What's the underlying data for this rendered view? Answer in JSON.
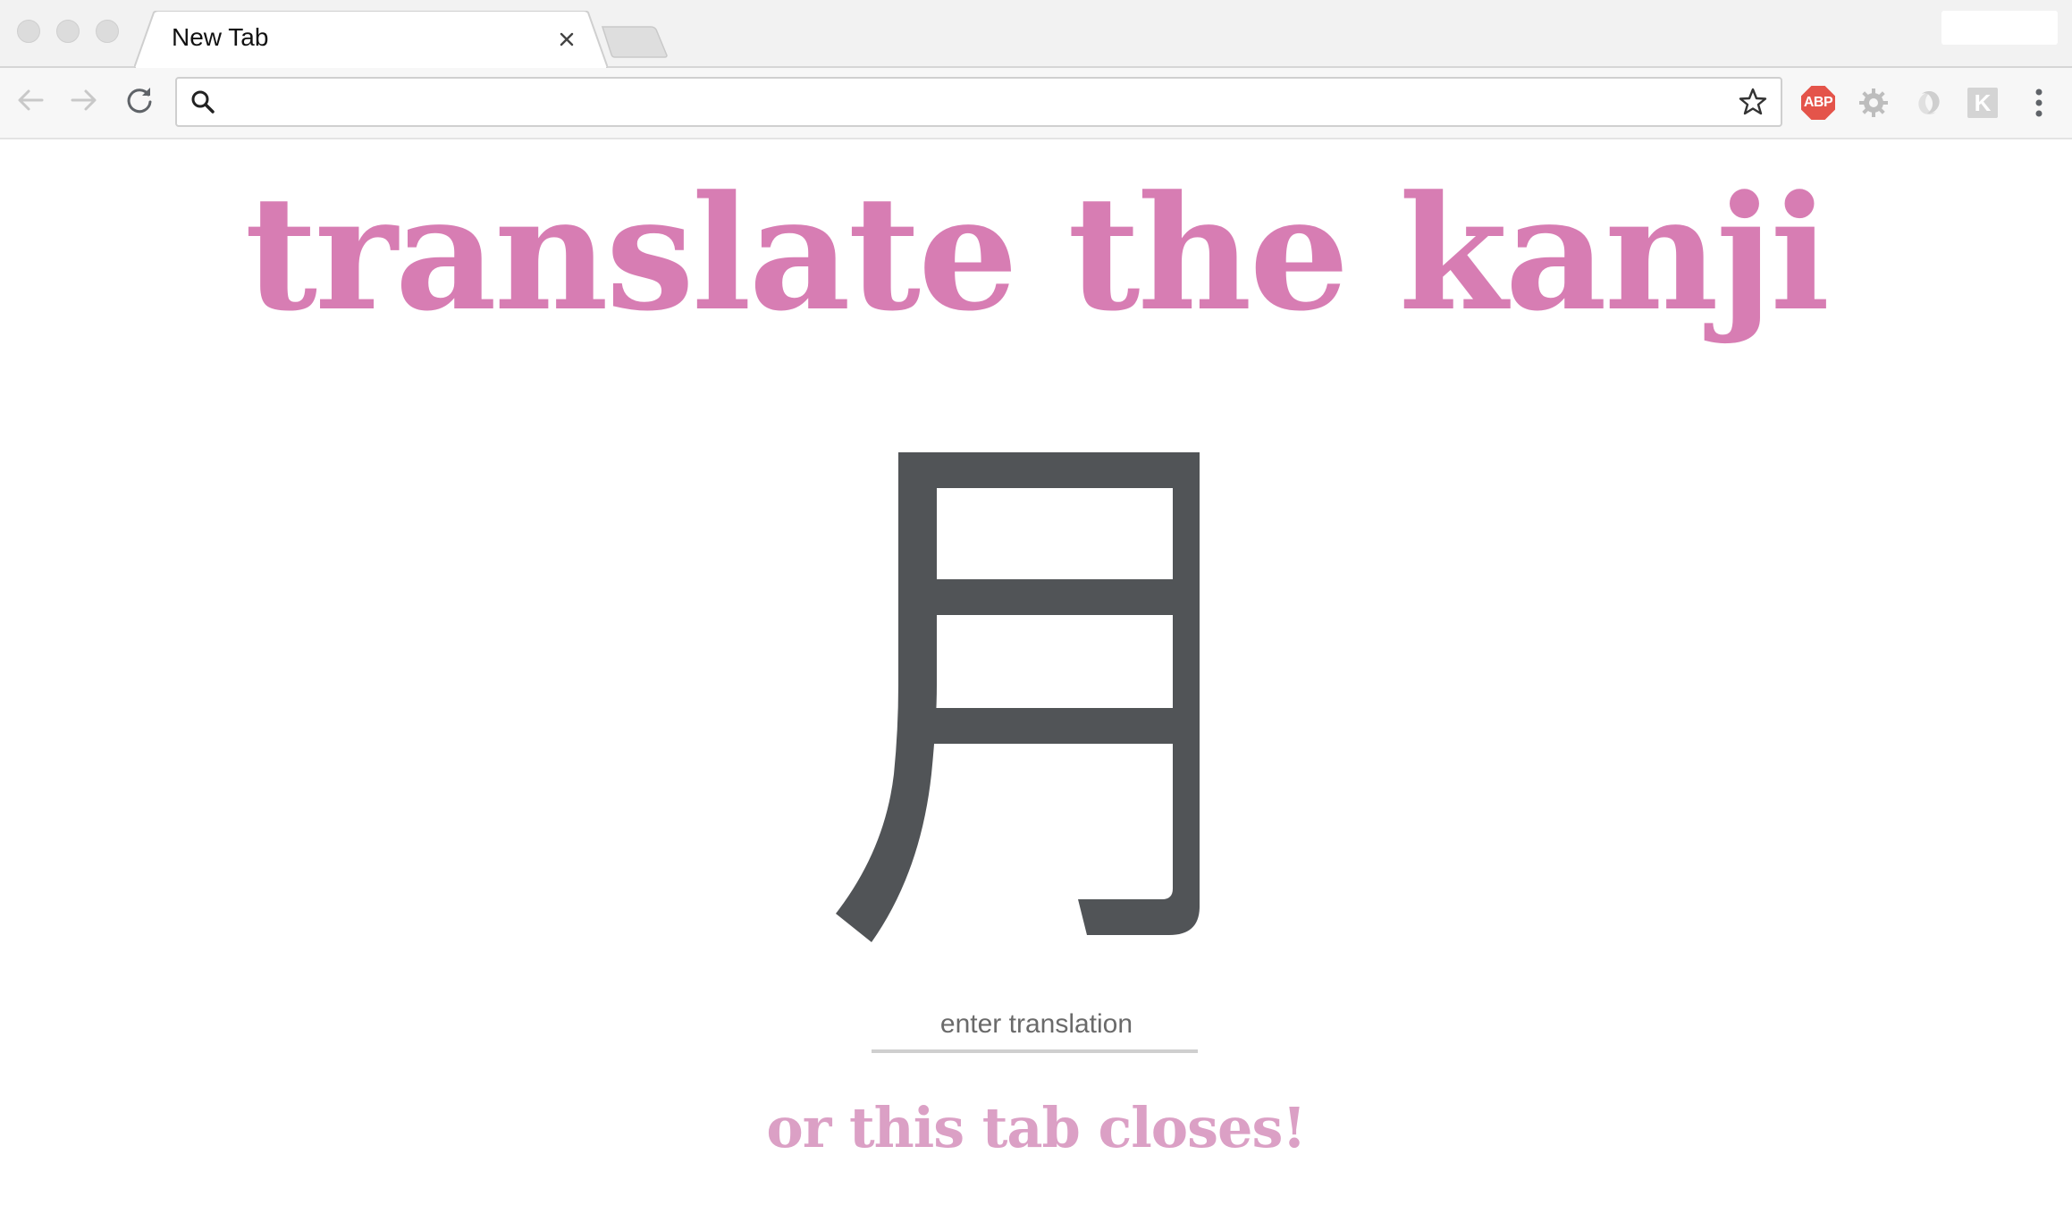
{
  "browser": {
    "tab": {
      "title": "New Tab",
      "close_icon": "close-icon"
    },
    "new_tab_icon": "new-tab-icon",
    "toolbar": {
      "back_icon": "arrow-left-icon",
      "forward_icon": "arrow-right-icon",
      "reload_icon": "reload-icon",
      "omnibox_value": "",
      "omnibox_search_icon": "search-icon",
      "bookmark_icon": "star-icon"
    },
    "extensions": [
      {
        "name": "abp-icon",
        "label": "ABP",
        "color": "#e4544a"
      },
      {
        "name": "gear-icon",
        "label": ""
      },
      {
        "name": "swirl-icon",
        "label": ""
      },
      {
        "name": "k-icon",
        "label": "K"
      }
    ],
    "menu_icon": "more-vertical-icon"
  },
  "page": {
    "headline": "translate the kanji",
    "kanji": "月",
    "translation": {
      "value": "",
      "placeholder": "enter translation"
    },
    "warning": "or this tab closes!",
    "colors": {
      "headline": "#d77db3",
      "warning": "#dba0c5",
      "kanji": "#515457"
    }
  }
}
